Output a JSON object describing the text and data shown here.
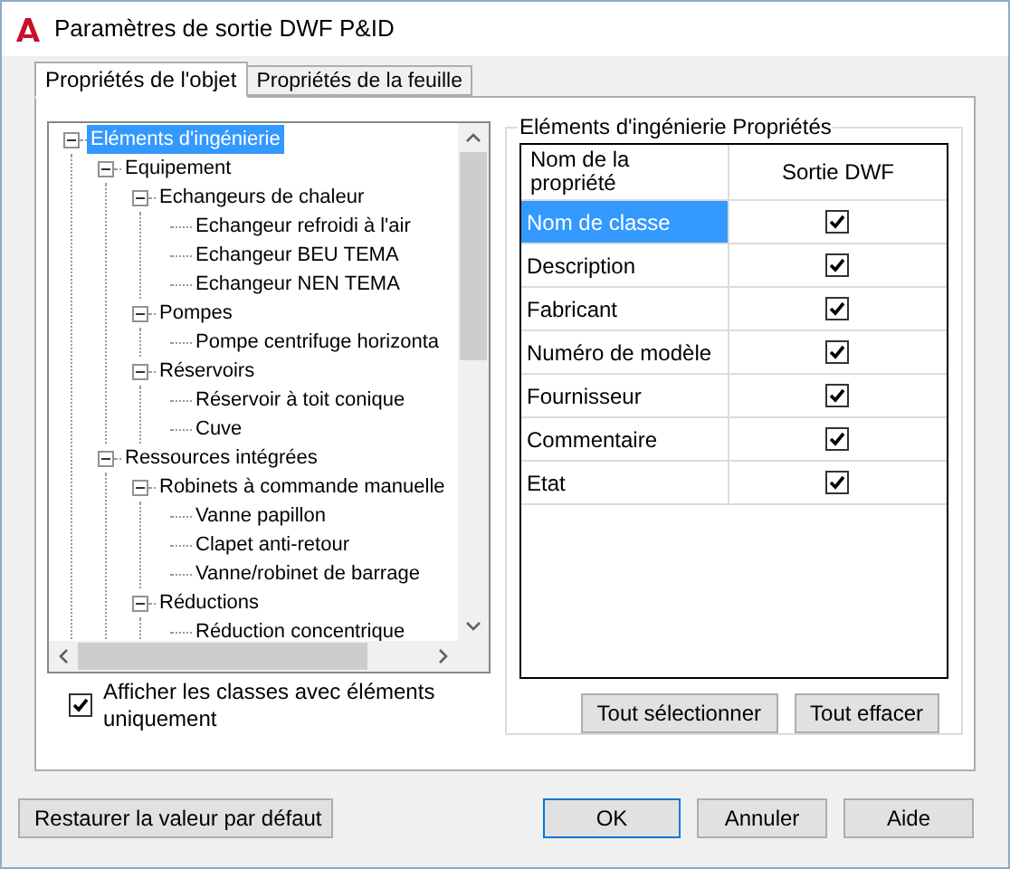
{
  "window": {
    "title": "Paramètres de sortie DWF P&ID"
  },
  "tabs": [
    {
      "label": "Propriétés de l'objet",
      "selected": true
    },
    {
      "label": "Propriétés de la feuille",
      "selected": false
    }
  ],
  "tree": {
    "items": [
      {
        "label": "Eléments d'ingénierie",
        "selected": true,
        "expanded": true,
        "children": [
          {
            "label": "Equipement",
            "selected": false,
            "expanded": true,
            "children": [
              {
                "label": "Echangeurs de chaleur",
                "selected": false,
                "expanded": true,
                "children": [
                  {
                    "label": "Echangeur refroidi à l'air",
                    "selected": false
                  },
                  {
                    "label": "Echangeur BEU TEMA",
                    "selected": false
                  },
                  {
                    "label": "Echangeur NEN TEMA",
                    "selected": false
                  }
                ]
              },
              {
                "label": "Pompes",
                "selected": false,
                "expanded": true,
                "children": [
                  {
                    "label": "Pompe centrifuge horizonta",
                    "selected": false
                  }
                ]
              },
              {
                "label": "Réservoirs",
                "selected": false,
                "expanded": true,
                "children": [
                  {
                    "label": "Réservoir à toit conique",
                    "selected": false
                  },
                  {
                    "label": "Cuve",
                    "selected": false
                  }
                ]
              }
            ]
          },
          {
            "label": "Ressources intégrées",
            "selected": false,
            "expanded": true,
            "children": [
              {
                "label": "Robinets à commande manuelle",
                "selected": false,
                "expanded": true,
                "children": [
                  {
                    "label": "Vanne papillon",
                    "selected": false
                  },
                  {
                    "label": "Clapet anti-retour",
                    "selected": false
                  },
                  {
                    "label": "Vanne/robinet de barrage",
                    "selected": false
                  }
                ]
              },
              {
                "label": "Réductions",
                "selected": false,
                "expanded": true,
                "children": [
                  {
                    "label": "Réduction concentrique",
                    "selected": false
                  }
                ]
              }
            ]
          }
        ]
      }
    ]
  },
  "show_classes_checkbox": {
    "label": "Afficher les classes avec éléments uniquement",
    "checked": true
  },
  "properties": {
    "title": "Eléments d'ingénierie Propriétés",
    "columns": [
      "Nom de la propriété",
      "Sortie DWF"
    ],
    "rows": [
      {
        "name": "Nom de classe",
        "selected": true,
        "output": true
      },
      {
        "name": "Description",
        "selected": false,
        "output": true
      },
      {
        "name": "Fabricant",
        "selected": false,
        "output": true
      },
      {
        "name": "Numéro de modèle",
        "selected": false,
        "output": true
      },
      {
        "name": "Fournisseur",
        "selected": false,
        "output": true
      },
      {
        "name": "Commentaire",
        "selected": false,
        "output": true
      },
      {
        "name": "Etat",
        "selected": false,
        "output": true
      }
    ],
    "buttons": [
      "Tout sélectionner",
      "Tout effacer"
    ]
  },
  "footer": {
    "restore_button": "Restaurer la valeur par défaut",
    "buttons": [
      {
        "label": "OK",
        "default": true
      },
      {
        "label": "Annuler",
        "default": false
      },
      {
        "label": "Aide",
        "default": false
      }
    ]
  }
}
